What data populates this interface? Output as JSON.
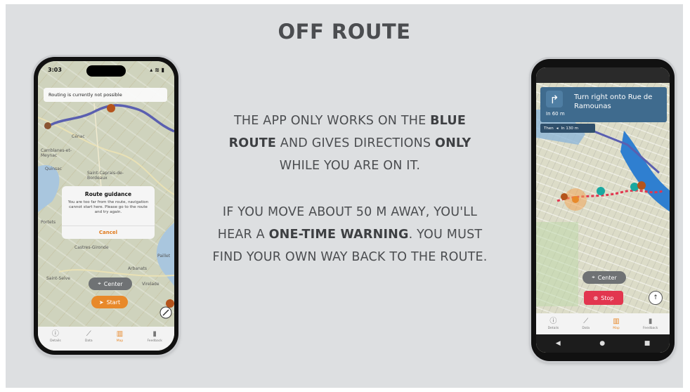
{
  "slide": {
    "title": "OFF ROUTE",
    "para1": [
      {
        "t": "THE APP ONLY WORKS ON THE ",
        "b": false
      },
      {
        "t": "BLUE",
        "b": true
      },
      {
        "t": "\n",
        "b": false
      },
      {
        "t": "ROUTE",
        "b": true
      },
      {
        "t": " AND GIVES DIRECTIONS ",
        "b": false
      },
      {
        "t": "ONLY",
        "b": true
      },
      {
        "t": "\nWHILE YOU ARE ON IT.",
        "b": false
      }
    ],
    "para2": [
      {
        "t": "IF YOU MOVE ABOUT 50 M AWAY, YOU'LL\nHEAR A ",
        "b": false
      },
      {
        "t": "ONE-TIME WARNING",
        "b": true
      },
      {
        "t": ". YOU MUST\nFIND YOUR OWN WAY BACK TO THE ROUTE.",
        "b": false
      }
    ]
  },
  "left_phone": {
    "time": "3:03",
    "status_icons": "▴ ≋ ▮",
    "banner": "Routing is currently not possible",
    "map_labels": [
      "Cénac",
      "Camblanes-et-Meynac",
      "Quinsac",
      "Saint-Caprais-de-Bordeaux",
      "Castres-Gironde",
      "Arbanats",
      "Virelade",
      "Saint-Selve",
      "Portets",
      "Paillet"
    ],
    "dialog": {
      "title": "Route guidance",
      "message": "You are too far from the route, navigation cannot start here. Please go to the route and try again.",
      "cancel": "Cancel"
    },
    "center_label": "Center",
    "start_label": "Start",
    "tabs": [
      {
        "label": "Details",
        "icon": "info-icon",
        "glyph": "ⓘ",
        "active": false
      },
      {
        "label": "Data",
        "icon": "chart-icon",
        "glyph": "⟋",
        "active": false
      },
      {
        "label": "Map",
        "icon": "map-icon",
        "glyph": "▥",
        "active": true
      },
      {
        "label": "Feedback",
        "icon": "feedback-icon",
        "glyph": "▮",
        "active": false
      }
    ]
  },
  "right_phone": {
    "instruction": "Turn right onto Rue de Ramounas",
    "distance": "In 60 m",
    "then_label": "Then",
    "then_distance": "In 130 m",
    "center_label": "Center",
    "stop_label": "Stop",
    "tabs": [
      {
        "label": "Details",
        "icon": "info-icon",
        "glyph": "ⓘ",
        "active": false
      },
      {
        "label": "Data",
        "icon": "chart-icon",
        "glyph": "⟋",
        "active": false
      },
      {
        "label": "Map",
        "icon": "map-icon",
        "glyph": "▥",
        "active": true
      },
      {
        "label": "Feedback",
        "icon": "feedback-icon",
        "glyph": "▮",
        "active": false
      }
    ]
  },
  "colors": {
    "route_blue": "#5a5fb0",
    "accent_orange": "#e8892a",
    "nav_card": "#3f6b8e",
    "stop_red": "#e2364f"
  }
}
